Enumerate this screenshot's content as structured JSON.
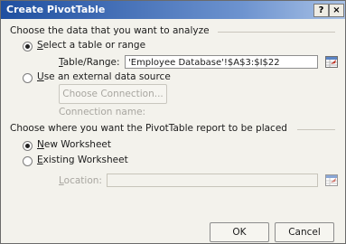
{
  "dialog": {
    "title": "Create PivotTable",
    "help_glyph": "?",
    "close_glyph": "×"
  },
  "analyze": {
    "heading": "Choose the data that you want to analyze",
    "select_range_prefix": "",
    "select_range_mnemonic": "S",
    "select_range_rest": "elect a table or range",
    "table_range_mnemonic": "T",
    "table_range_rest": "able/Range:",
    "table_range_value": "'Employee Database'!$A$3:$I$22",
    "external_mnemonic": "U",
    "external_rest": "se an external data source",
    "choose_connection_label": "Choose Connection...",
    "connection_name_label": "Connection name:"
  },
  "placement": {
    "heading": "Choose where you want the PivotTable report to be placed",
    "new_ws_mnemonic": "N",
    "new_ws_rest": "ew Worksheet",
    "existing_ws_mnemonic": "E",
    "existing_ws_rest": "xisting Worksheet",
    "location_mnemonic": "L",
    "location_rest": "ocation:",
    "location_value": ""
  },
  "buttons": {
    "ok": "OK",
    "cancel": "Cancel"
  },
  "state": {
    "select_range_selected": true,
    "external_selected": false,
    "new_ws_selected": true,
    "existing_ws_selected": false
  },
  "colors": {
    "titlebar_start": "#1f4fa0",
    "titlebar_end": "#a9c2e6",
    "dialog_bg": "#f3f2ec"
  }
}
